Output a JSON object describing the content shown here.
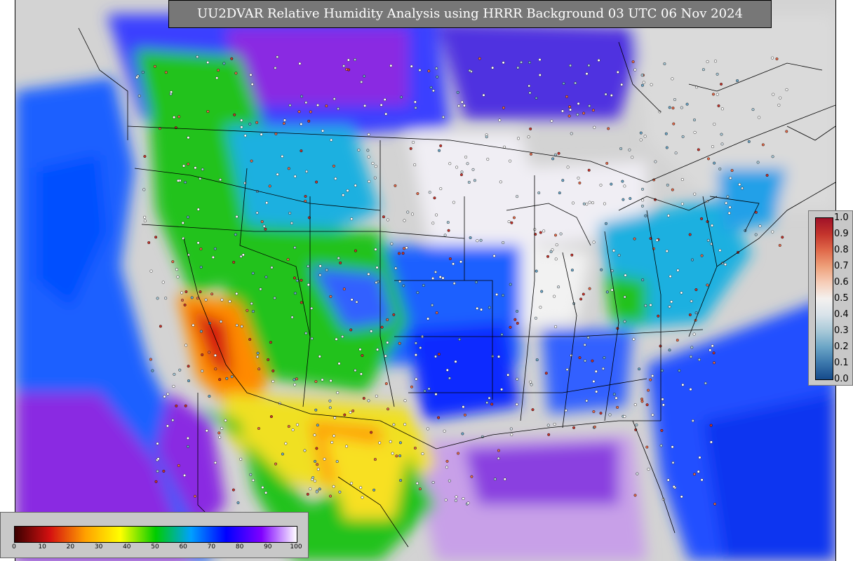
{
  "title": "UU2DVAR Relative Humidity Analysis using HRRR Background 03 UTC 06 Nov 2024",
  "rh_colorbar": {
    "ticks": [
      "1.0",
      "0.9",
      "0.8",
      "0.7",
      "0.6",
      "0.5",
      "0.4",
      "0.3",
      "0.2",
      "0.1",
      "0.0"
    ],
    "colors": [
      "#a01228",
      "#c4342c",
      "#e0694a",
      "#eea07a",
      "#f6cdb8",
      "#f4f1ef",
      "#d9e3ea",
      "#a8c9d8",
      "#6ba5c6",
      "#3b77ac",
      "#154a8a"
    ]
  },
  "scale_colorbar": {
    "ticks": [
      "0",
      "10",
      "20",
      "30",
      "40",
      "50",
      "60",
      "70",
      "80",
      "90",
      "100"
    ],
    "colors": [
      "#3a0000",
      "#d41010",
      "#ffa000",
      "#ffff00",
      "#00cc00",
      "#00a0ff",
      "#0000ff",
      "#8000ff",
      "#ffffff"
    ]
  },
  "map_colors": {
    "background": "#d3d3d3",
    "ocean_blue": "#1e60ff",
    "violet": "#8a2be2",
    "white_humid": "#f2f2f2",
    "green_dry": "#22c21a",
    "yellow_dry": "#f0e020",
    "orange_dry": "#ff8a00",
    "cyan": "#1ab0e0"
  }
}
